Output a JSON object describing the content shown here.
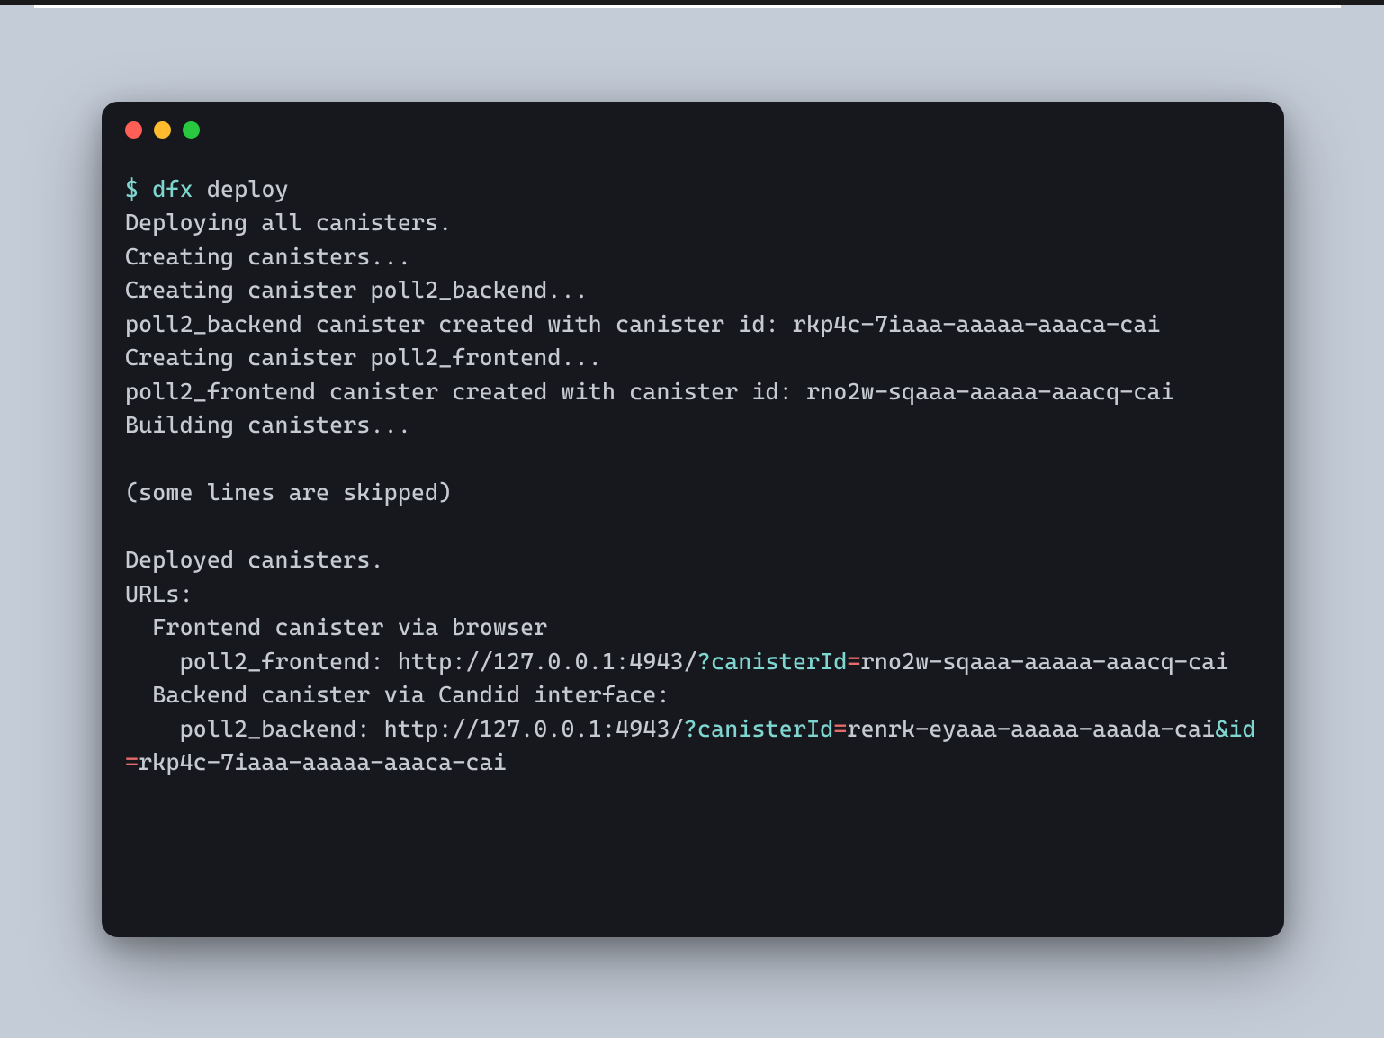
{
  "terminal": {
    "prompt": "$",
    "command": "dfx",
    "arg": "deploy",
    "lines": {
      "l1": "Deploying all canisters.",
      "l2": "Creating canisters...",
      "l3": "Creating canister poll2_backend...",
      "l4": "poll2_backend canister created with canister id: rkp4c-7iaaa-aaaaa-aaaca-cai",
      "l5": "Creating canister poll2_frontend...",
      "l6": "poll2_frontend canister created with canister id: rno2w-sqaaa-aaaaa-aaacq-cai",
      "l7": "Building canisters...",
      "l8": "(some lines are skipped)",
      "l9": "Deployed canisters.",
      "l10": "URLs:",
      "l11": "  Frontend canister via browser",
      "frontend_prefix": "    poll2_frontend: http://127.0.0.1:4943/",
      "frontend_q": "?canisterId",
      "frontend_eq": "=",
      "frontend_val": "rno2w-sqaaa-aaaaa-aaacq-cai",
      "l13": "  Backend canister via Candid interface:",
      "backend_prefix": "    poll2_backend: http://127.0.0.1:4943/",
      "backend_q1": "?canisterId",
      "backend_eq1": "=",
      "backend_val1": "renrk-eyaaa-aaaaa-aaada-cai",
      "backend_amp": "&",
      "backend_q2": "id",
      "backend_eq2": "=",
      "backend_val2": "rkp4c-7iaaa-aaaaa-aaaca-cai"
    }
  }
}
